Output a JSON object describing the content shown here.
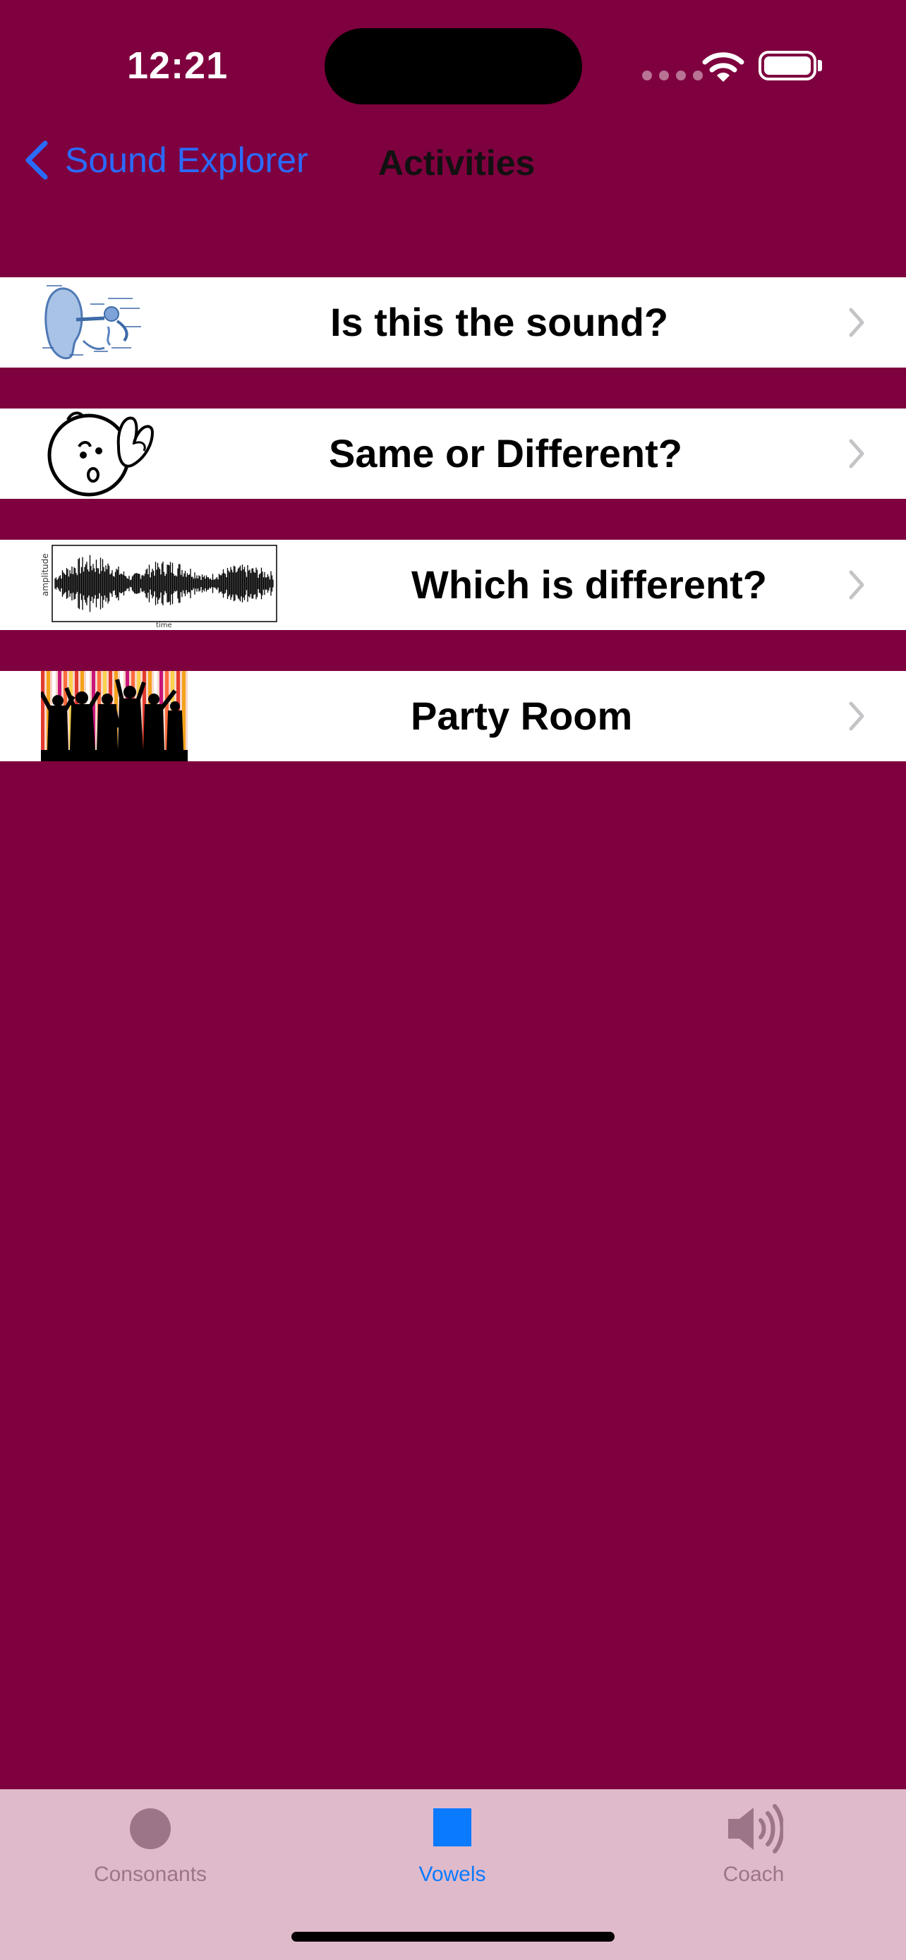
{
  "status_bar": {
    "time": "12:21"
  },
  "nav": {
    "back_label": "Sound Explorer",
    "title": "Activities"
  },
  "activities": [
    {
      "label": "Is this the sound?",
      "thumbnail": "ear-anatomy-diagram"
    },
    {
      "label": "Same or Different?",
      "thumbnail": "listening-face-cartoon"
    },
    {
      "label": "Which is different?",
      "thumbnail": "waveform-plot"
    },
    {
      "label": "Party Room",
      "thumbnail": "dancing-crowd-silhouette"
    }
  ],
  "tabs": [
    {
      "label": "Consonants",
      "icon": "circle-icon",
      "selected": false
    },
    {
      "label": "Vowels",
      "icon": "square-icon",
      "selected": true
    },
    {
      "label": "Coach",
      "icon": "speaker-icon",
      "selected": false
    }
  ],
  "colors": {
    "background": "#7f003e",
    "tab_bar": "#dfbacb",
    "accent": "#2a6bff",
    "tab_selected": "#0a7aff",
    "tab_unselected": "#9c7688"
  }
}
